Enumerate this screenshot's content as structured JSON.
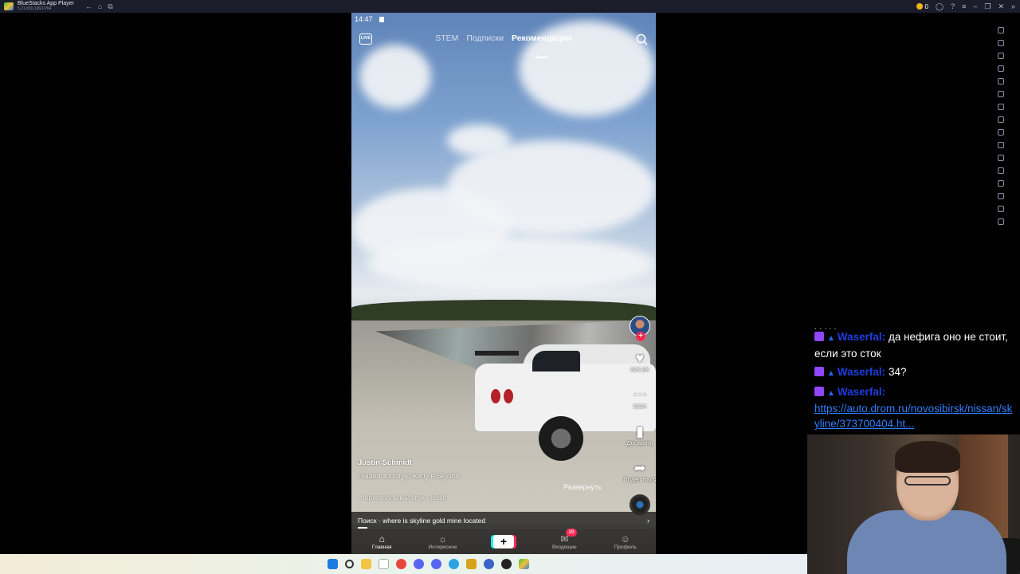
{
  "window": {
    "title": "BlueStacks App Player",
    "subtitle": "5.21.650.1063 P64",
    "coins": "0"
  },
  "phone": {
    "status": {
      "time": "14:47"
    },
    "top_tabs": [
      {
        "label": "STEM"
      },
      {
        "label": "Подписки"
      },
      {
        "label": "Рекомендации"
      }
    ],
    "actions": {
      "likes": "525.8K",
      "comments": "5624",
      "saves": "Добавить",
      "shares": "Поделиться"
    },
    "caption": {
      "author": "Justin Schmidt",
      "description": "Нашел золотую жилу в Skyline",
      "music": "♫ оригинальный звук - justin",
      "expand": "Развернуть"
    },
    "search_suggestion": "Поиск · where is skyline gold mine located",
    "bottom_nav": [
      {
        "label": "Главная"
      },
      {
        "label": "Интересное"
      },
      {
        "label": ""
      },
      {
        "label": "Входящие",
        "badge": "39"
      },
      {
        "label": "Профиль"
      }
    ]
  },
  "chat": {
    "partial_line": ", , ,  , ,",
    "messages": [
      {
        "user": "Waserfal:",
        "text": "да нефига оно не стоит, если это сток"
      },
      {
        "user": "Waserfal:",
        "text": "34?"
      },
      {
        "user": "Waserfal:",
        "link": "https://auto.drom.ru/novosibirsk/nissan/skyline/373700404.ht..."
      }
    ]
  },
  "colors": {
    "tiktok_red": "#fe2c55",
    "tiktok_cyan": "#25f4ee",
    "twitch_purple": "#9146ff",
    "chat_user": "#1e3ddf"
  }
}
